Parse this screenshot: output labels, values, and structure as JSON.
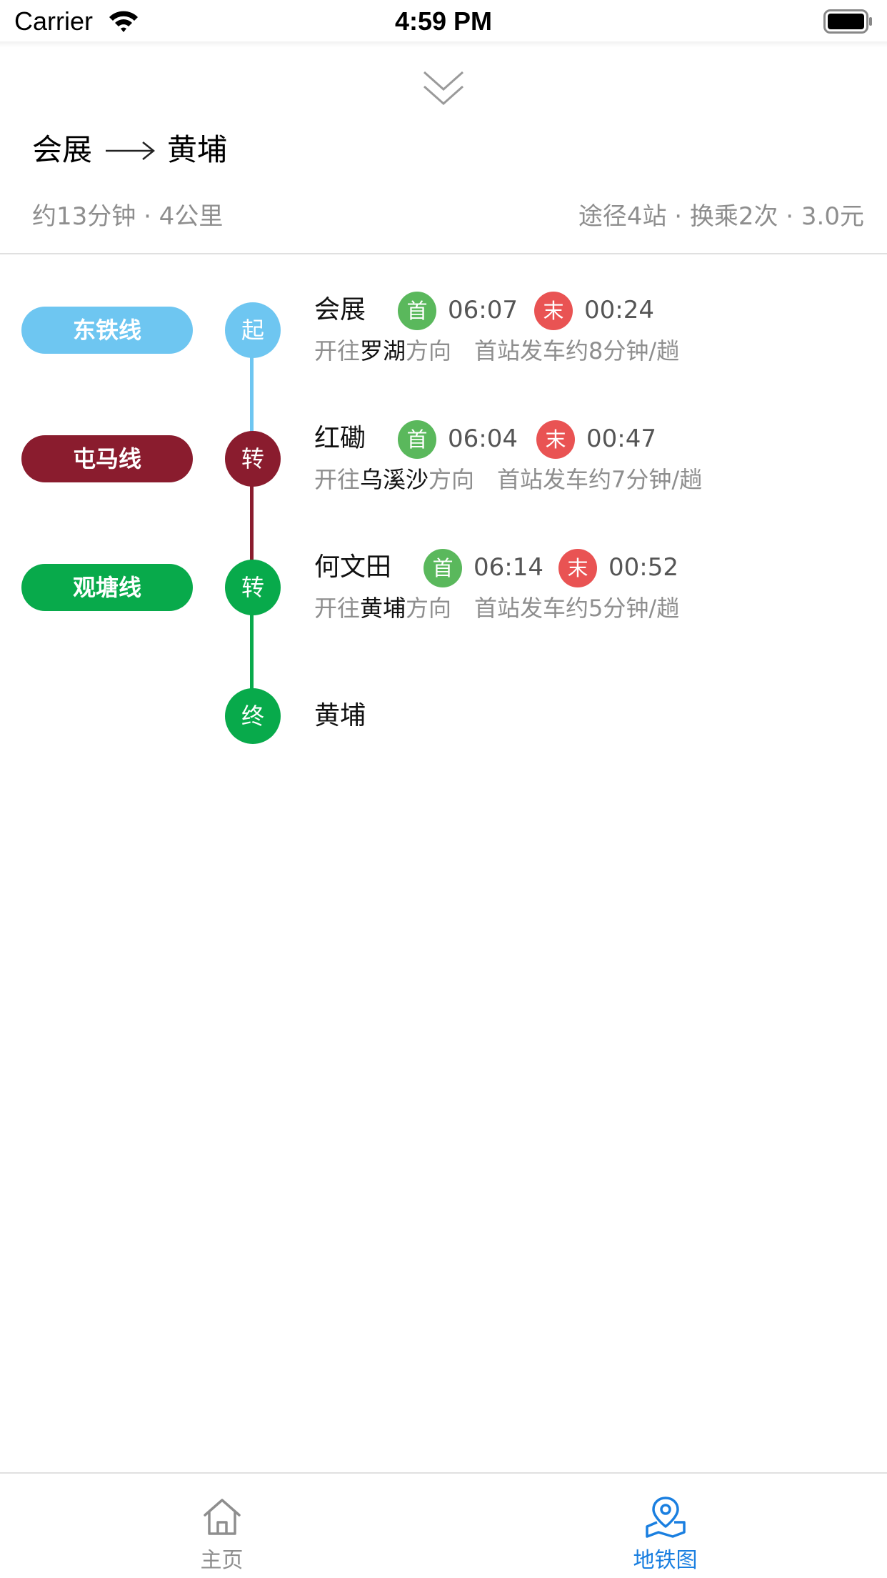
{
  "status_bar": {
    "carrier": "Carrier",
    "time": "4:59 PM"
  },
  "header": {
    "collapse_icon": "chevrons-down-icon"
  },
  "route": {
    "from": "会展",
    "to": "黄埔",
    "summary_left": "约13分钟 · 4公里",
    "summary_right": "途径4站 · 换乘2次 · 3.0元"
  },
  "colors": {
    "east_rail": "#6ec6f1",
    "tuen_ma": "#8a1c2e",
    "kwun_tong": "#08aa4b",
    "first_badge": "#5ab85c",
    "last_badge": "#e95353",
    "tab_active": "#1a7fe0",
    "tab_inactive": "#8e8e8e"
  },
  "legs": [
    {
      "line": "东铁线",
      "node_label": "起",
      "station": "会展",
      "first_badge": "首",
      "first_time": "06:07",
      "last_badge": "末",
      "last_time": "00:24",
      "dir_prefix": "开往",
      "dir_station": "罗湖",
      "dir_suffix": "方向",
      "frequency": "首站发车约8分钟/趟"
    },
    {
      "line": "屯马线",
      "node_label": "转",
      "station": "红磡",
      "first_badge": "首",
      "first_time": "06:04",
      "last_badge": "末",
      "last_time": "00:47",
      "dir_prefix": "开往",
      "dir_station": "乌溪沙",
      "dir_suffix": "方向",
      "frequency": "首站发车约7分钟/趟"
    },
    {
      "line": "观塘线",
      "node_label": "转",
      "station": "何文田",
      "first_badge": "首",
      "first_time": "06:14",
      "last_badge": "末",
      "last_time": "00:52",
      "dir_prefix": "开往",
      "dir_station": "黄埔",
      "dir_suffix": "方向",
      "frequency": "首站发车约5分钟/趟"
    }
  ],
  "end": {
    "node_label": "终",
    "station": "黄埔"
  },
  "tabs": [
    {
      "label": "主页",
      "icon": "home-icon",
      "active": false
    },
    {
      "label": "地铁图",
      "icon": "map-pin-icon",
      "active": true
    }
  ]
}
